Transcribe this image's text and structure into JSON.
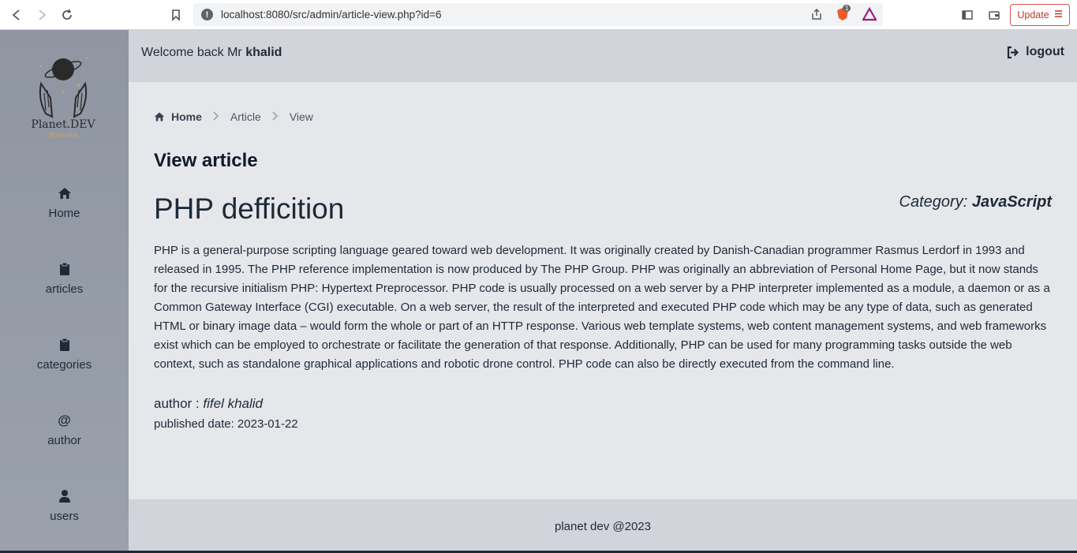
{
  "browser": {
    "url": "localhost:8080/src/admin/article-view.php?id=6",
    "update_label": "Update",
    "shield_badge": "1"
  },
  "sidebar": {
    "items": [
      {
        "label": "Home",
        "icon": "home-icon"
      },
      {
        "label": "articles",
        "icon": "clipboard-icon"
      },
      {
        "label": "categories",
        "icon": "clipboard-icon"
      },
      {
        "label": "author",
        "icon": "at-icon"
      },
      {
        "label": "users",
        "icon": "user-icon"
      }
    ]
  },
  "header": {
    "welcome_prefix": "Welcome back Mr",
    "username": "khalid",
    "logout_label": "logout"
  },
  "breadcrumb": {
    "home": "Home",
    "article": "Article",
    "view": "View"
  },
  "page": {
    "title": "View article"
  },
  "article": {
    "title": "PHP defficition",
    "category_label": "Category:",
    "category": "JavaScript",
    "body": "PHP is a general-purpose scripting language geared toward web development. It was originally created by Danish-Canadian programmer Rasmus Lerdorf in 1993 and released in 1995. The PHP reference implementation is now produced by The PHP Group. PHP was originally an abbreviation of Personal Home Page, but it now stands for the recursive initialism PHP: Hypertext Preprocessor. PHP code is usually processed on a web server by a PHP interpreter implemented as a module, a daemon or as a Common Gateway Interface (CGI) executable. On a web server, the result of the interpreted and executed PHP code which may be any type of data, such as generated HTML or binary image data – would form the whole or part of an HTTP response. Various web template systems, web content management systems, and web frameworks exist which can be employed to orchestrate or facilitate the generation of that response. Additionally, PHP can be used for many programming tasks outside the web context, such as standalone graphical applications and robotic drone control. PHP code can also be directly executed from the command line.",
    "author_label": "author :",
    "author": "fifel khalid",
    "published_label": "published date:",
    "published_date": "2023-01-22"
  },
  "footer": {
    "text": "planet dev @2023"
  }
}
